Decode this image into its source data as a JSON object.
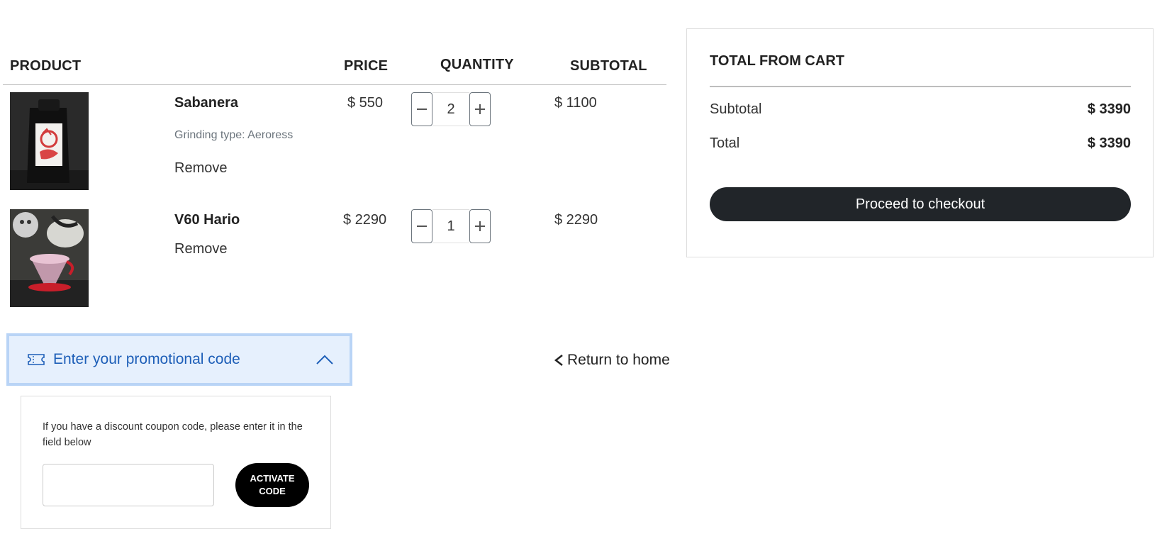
{
  "cart": {
    "headers": {
      "product": "PRODUCT",
      "price": "PRICE",
      "quantity": "QUANTITY",
      "subtotal": "SUBTOTAL"
    },
    "items": [
      {
        "name": "Sabanera",
        "grinding": "Grinding type: Aeroress",
        "remove": "Remove",
        "price": "$ 550",
        "quantity": "2",
        "subtotal": "$ 1100"
      },
      {
        "name": "V60 Hario",
        "remove": "Remove",
        "price": "$ 2290",
        "quantity": "1",
        "subtotal": "$ 2290"
      }
    ]
  },
  "promo": {
    "toggle_label": "Enter your promotional code",
    "description": "If you have a discount coupon code, please enter it in the field below",
    "input_value": "",
    "activate_label": "ACTIVATE CODE"
  },
  "return_label": "Return to home",
  "summary": {
    "title": "TOTAL FROM CART",
    "subtotal_label": "Subtotal",
    "subtotal_value": "$ 3390",
    "total_label": "Total",
    "total_value": "$ 3390",
    "checkout_label": "Proceed to checkout"
  },
  "colors": {
    "accent_dark": "#212529",
    "promo_bg": "#e6f0fd",
    "promo_border": "#b9d4f6",
    "promo_text": "#1e5fb8"
  },
  "icons": [
    "minus-icon",
    "plus-icon",
    "ticket-icon",
    "chevron-up-icon",
    "chevron-left-icon"
  ]
}
